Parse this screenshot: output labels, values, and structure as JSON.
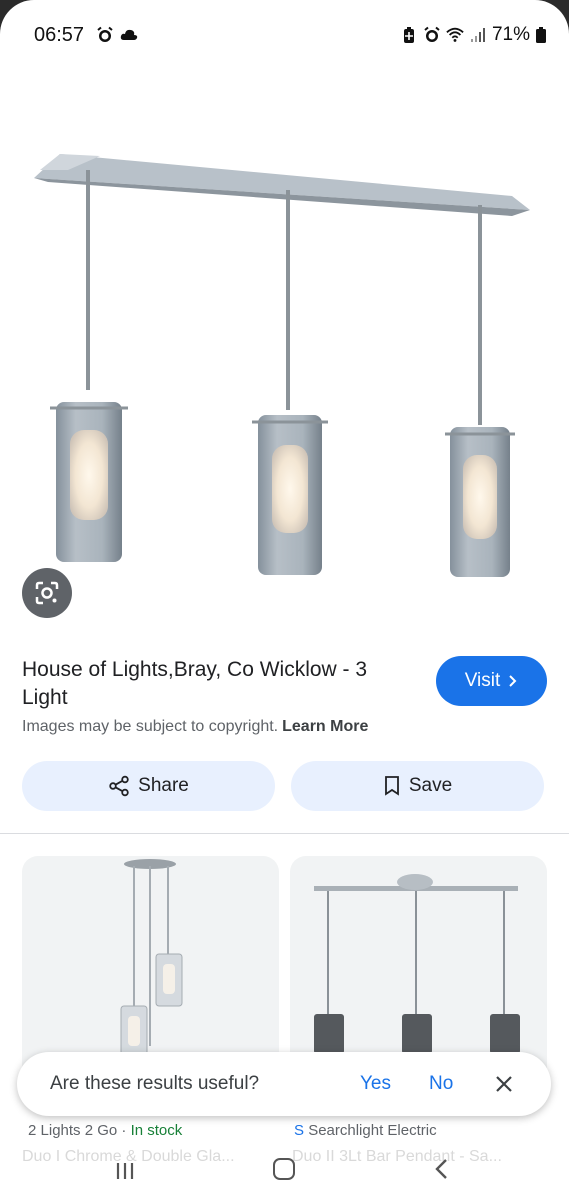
{
  "status_bar": {
    "time": "06:57",
    "battery": "71%",
    "left_icons": [
      "alarm-icon",
      "cloud-icon"
    ],
    "right_icons": [
      "battery-saver-icon",
      "alarm-icon",
      "wifi-icon",
      "signal-icon",
      "battery-icon"
    ]
  },
  "result": {
    "title": "House of Lights,Bray, Co Wicklow - 3 Light",
    "visit_label": "Visit",
    "copyright_text": "Images may be subject to copyright.",
    "learn_more": "Learn More",
    "share_label": "Share",
    "save_label": "Save"
  },
  "related": [
    {
      "meta_prefix": "2",
      "source": "Lights 2 Go",
      "separator": "·",
      "availability": "In stock",
      "title": "Duo I Chrome & Double Gla..."
    },
    {
      "meta_prefix": "S",
      "source": "Searchlight Electric",
      "title": "Duo II 3Lt Bar Pendant - Sa..."
    }
  ],
  "feedback": {
    "question": "Are these results useful?",
    "yes": "Yes",
    "no": "No"
  },
  "colors": {
    "accent": "#1a73e8",
    "button_bg": "#e8f0fe",
    "in_stock": "#188038"
  }
}
